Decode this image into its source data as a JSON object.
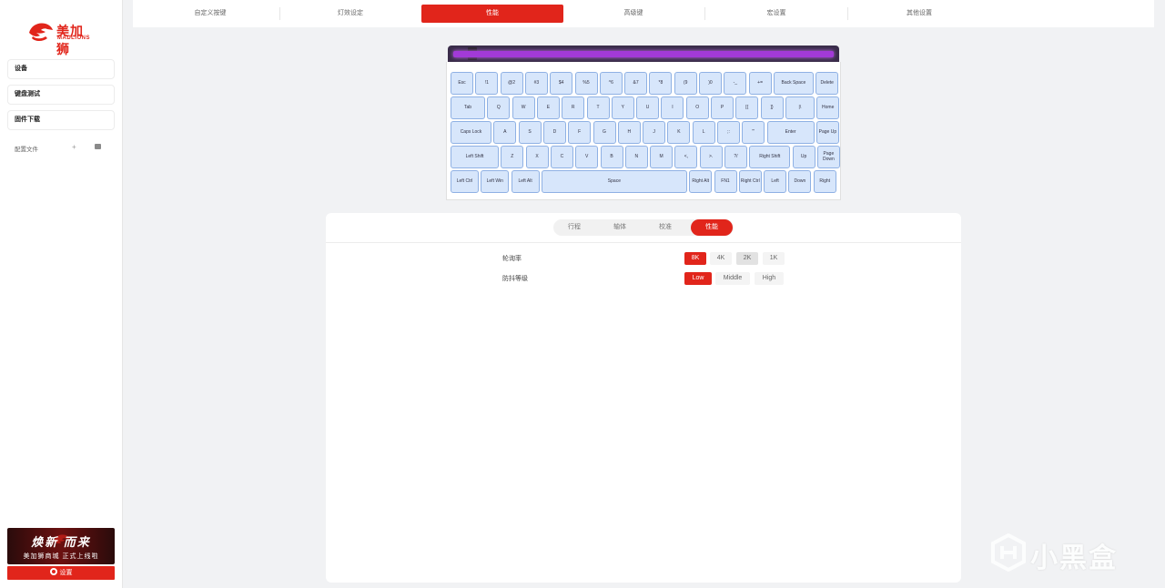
{
  "brand": {
    "name_cn": "美加狮",
    "name_en": "MADLIONS"
  },
  "sidebar": {
    "items": [
      {
        "label": "设备"
      },
      {
        "label": "键盘测试"
      },
      {
        "label": "固件下载"
      }
    ],
    "profile_label": "配置文件",
    "profile_add": "+",
    "banner": {
      "title": "焕新   而来",
      "subtitle": "美加狮商城 正式上线啦"
    },
    "settings_label": "设置"
  },
  "top_tabs": [
    {
      "label": "自定义按键"
    },
    {
      "label": "灯效设定"
    },
    {
      "label": "性能",
      "active": true
    },
    {
      "label": "高级键"
    },
    {
      "label": "宏设置"
    },
    {
      "label": "其他设置"
    }
  ],
  "keyboard": {
    "rows": [
      [
        "Esc",
        "!1",
        "@2",
        "#3",
        "$4",
        "%5",
        "^6",
        "&7",
        "*8",
        "(9",
        ")0",
        "-_",
        "+=",
        "Back Space",
        "Delete"
      ],
      [
        "Tab",
        "Q",
        "W",
        "E",
        "R",
        "T",
        "Y",
        "U",
        "I",
        "O",
        "P",
        "[{",
        "]}",
        "|\\",
        "Home"
      ],
      [
        "Caps Lock",
        "A",
        "S",
        "D",
        "F",
        "G",
        "H",
        "J",
        "K",
        "L",
        ";:",
        "'\"",
        "Enter",
        "Page Up"
      ],
      [
        "Left Shift",
        "Z",
        "X",
        "C",
        "V",
        "B",
        "N",
        "M",
        "<,",
        ">.",
        "?/",
        "Right Shift",
        "Up",
        "Page Down"
      ],
      [
        "Left Ctrl",
        "Left Win",
        "Left Alt",
        "Space",
        "Right Alt",
        "FN1",
        "Right Ctrl",
        "Left",
        "Down",
        "Right"
      ]
    ]
  },
  "performance": {
    "sub_tabs": [
      {
        "label": "行程"
      },
      {
        "label": "轴体"
      },
      {
        "label": "校准"
      },
      {
        "label": "性能",
        "active": true
      }
    ],
    "polling_rate": {
      "label": "轮询率",
      "options": [
        "8K",
        "4K",
        "2K",
        "1K"
      ],
      "selected": "8K"
    },
    "debounce": {
      "label": "防抖等级",
      "options": [
        "Low",
        "Middle",
        "High"
      ],
      "selected": "Low"
    }
  },
  "watermark": {
    "text": "小黑盒"
  },
  "colors": {
    "accent": "#e1251b",
    "key_fill": "#d7e6fb",
    "key_border": "#8fb1e4",
    "light_bar": "#a23ad8"
  }
}
